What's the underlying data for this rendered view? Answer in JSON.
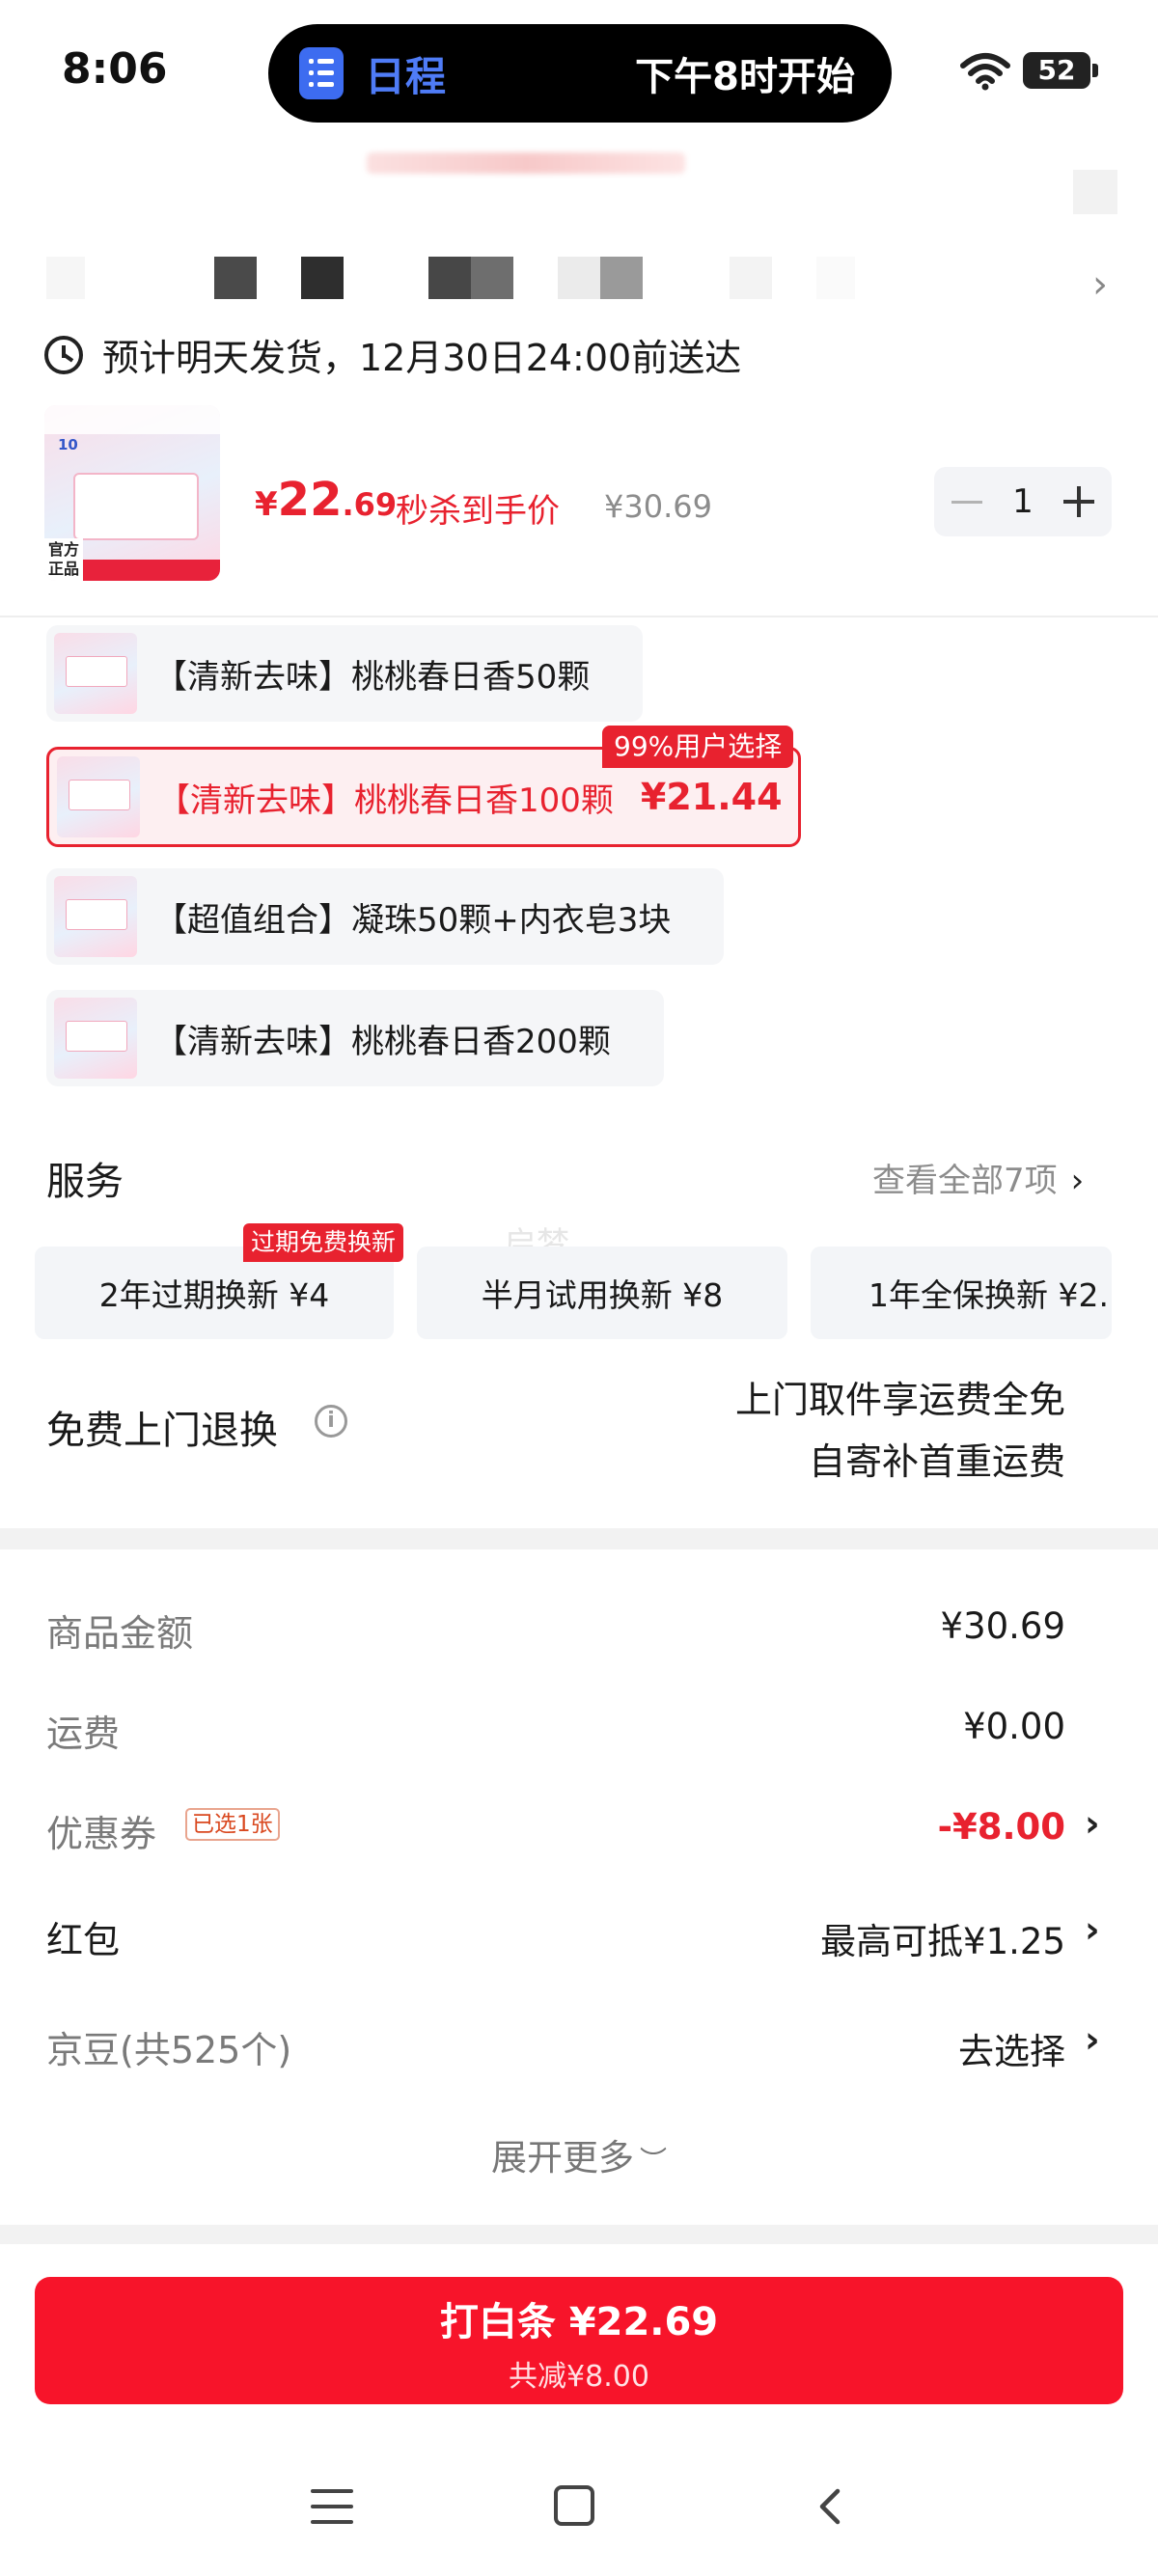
{
  "status_bar": {
    "time": "8:06",
    "island_app": "日程",
    "island_text": "下午8时开始",
    "battery": "52"
  },
  "delivery": {
    "text": "预计明天发货，12月30日24:00前送达"
  },
  "product": {
    "price_currency": "¥",
    "price_int": "22",
    "price_dec": ".69",
    "price_tag": "秒杀到手价",
    "original_price": "¥30.69",
    "quantity": "1",
    "thumb_badge": "官方正品"
  },
  "variants": [
    {
      "label": "【清新去味】桃桃春日香50颗",
      "price": "",
      "selected": false
    },
    {
      "label": "【清新去味】桃桃春日香100颗",
      "price": "¥21.44",
      "selected": true
    },
    {
      "label": "【超值组合】凝珠50颗+内衣皂3块",
      "price": "",
      "selected": false
    },
    {
      "label": "【清新去味】桃桃春日香200颗",
      "price": "",
      "selected": false
    }
  ],
  "variant_badge": "99%用户选择",
  "services": {
    "title": "服务",
    "view_all": "查看全部7项",
    "items": [
      {
        "label": "2年过期换新  ¥4"
      },
      {
        "label": "半月试用换新  ¥8"
      },
      {
        "label": "1年全保换新  ¥2."
      }
    ],
    "badge": "过期免费换新",
    "watermark": "启梦"
  },
  "free_return": {
    "title": "免费上门退换",
    "line1": "上门取件享运费全免",
    "line2": "自寄补首重运费"
  },
  "summary": {
    "goods_label": "商品金额",
    "goods_value": "¥30.69",
    "shipping_label": "运费",
    "shipping_value": "¥0.00",
    "coupon_label": "优惠券",
    "coupon_tag": "已选1张",
    "coupon_value": "-¥8.00",
    "redpacket_label": "红包",
    "redpacket_value": "最高可抵¥1.25",
    "jingdou_label": "京豆(共525个)",
    "jingdou_value": "去选择",
    "expand_label": "展开更多"
  },
  "pay_button": {
    "main": "打白条 ¥22.69",
    "sub": "共减¥8.00"
  },
  "colors": {
    "accent_red": "#e8222f",
    "pay_red": "#f7142a",
    "island_blue": "#4f7cf7"
  }
}
